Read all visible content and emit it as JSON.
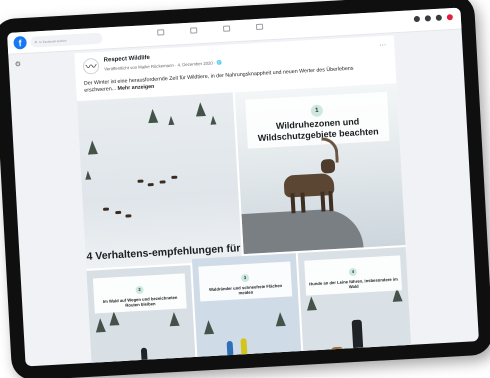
{
  "topbar": {
    "logo": "f",
    "search_placeholder": "In Facebook suchen"
  },
  "post": {
    "page_name": "Respect Wildlife",
    "meta": "Veröffentlicht von Maike Rückemann · 4. Dezember 2020 · 🌐",
    "more": "···",
    "text": "Der Winter ist eine herausfordernde Zeit für Wildtiere, in der Nahrungsknappheit und neuen Werter des Überlebens erschweren...",
    "see_more": "Mehr anzeigen"
  },
  "tiles": {
    "snow_caption": "4 Verhaltens-empfehlungen für",
    "ibex_number": "1",
    "ibex_title": "Wildruhezonen und Wildschutzgebiete beachten",
    "walk1_number": "2",
    "walk1_text": "Im Wald auf Wegen und bezeichneten Routen bleiben",
    "walk2_number": "3",
    "walk2_text": "Waldränder und schneefreie Flächen meiden",
    "walk3_number": "4",
    "walk3_text": "Hunde an der Leine führen, insbesondere im Wald"
  },
  "colors": {
    "brand": "#1877f2",
    "accent_circle": "#cde9df"
  }
}
